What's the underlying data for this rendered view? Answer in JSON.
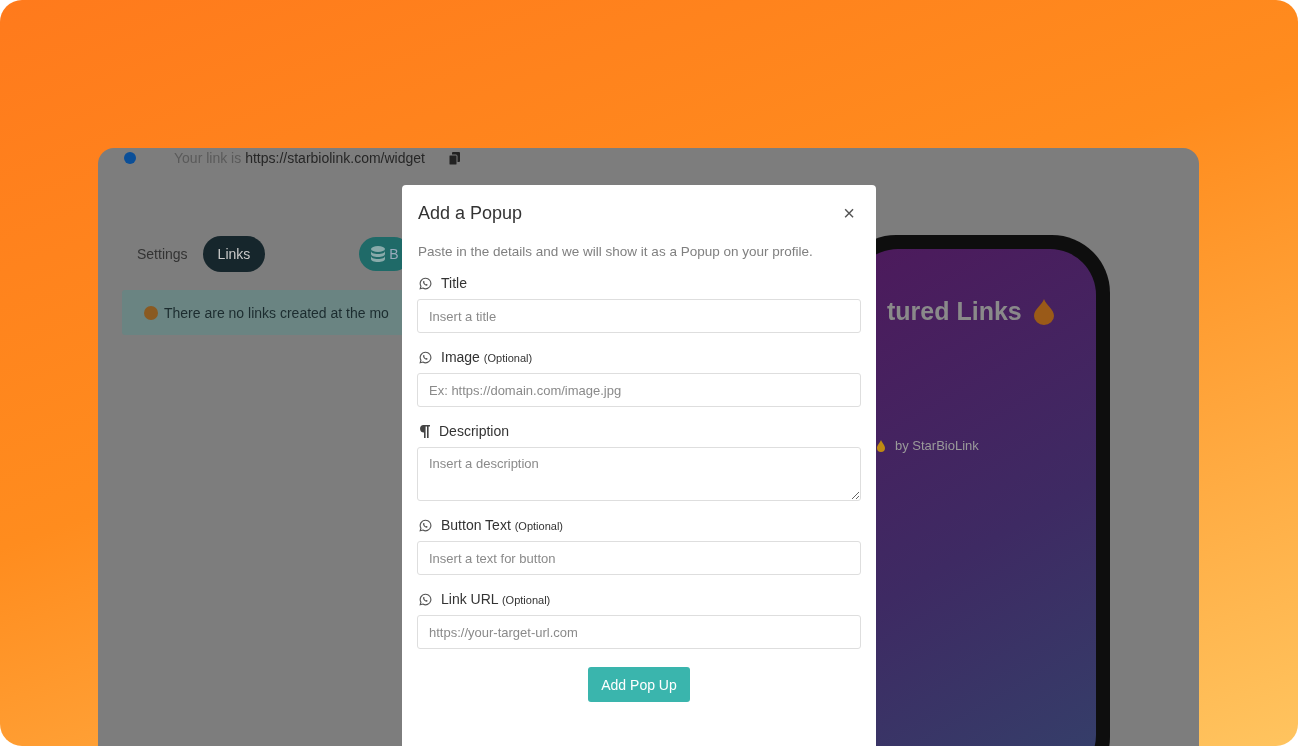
{
  "link_bar": {
    "label": "Your link is",
    "url": "https://starbiolink.com/widget"
  },
  "tabs": [
    {
      "label": "Settings",
      "selected": false
    },
    {
      "label": "Links",
      "selected": true
    }
  ],
  "action_button": {
    "label": "B"
  },
  "alert": {
    "text": "There are no links created at the mo"
  },
  "preview": {
    "heading": "tured Links",
    "credit": "by StarBioLink"
  },
  "modal": {
    "title": "Add a Popup",
    "close": "×",
    "description": "Paste in the details and we will show it as a Popup on your profile.",
    "fields": [
      {
        "kind": "text",
        "label": "Title",
        "placeholder": "Insert a title"
      },
      {
        "kind": "text",
        "label": "Image",
        "note": "(Optional)",
        "placeholder": "Ex: https://domain.com/image.jpg"
      },
      {
        "kind": "multiline",
        "label": "Description",
        "placeholder": "Insert a description"
      },
      {
        "kind": "text",
        "label": "Button Text",
        "note": "(Optional)",
        "placeholder": "Insert a text for button"
      },
      {
        "kind": "text",
        "label": "Link URL",
        "note": "(Optional)",
        "placeholder": "https://your-target-url.com"
      }
    ],
    "submit": "Add Pop Up"
  }
}
